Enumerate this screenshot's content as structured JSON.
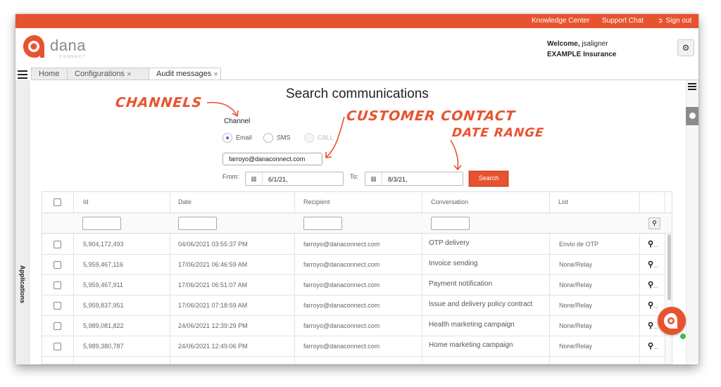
{
  "topbar": {
    "links": [
      "Knowledge Center",
      "Support Chat",
      "Sign out"
    ],
    "color": "#e8532f"
  },
  "logo": {
    "word": "dana",
    "sub": "CONNECT"
  },
  "header": {
    "welcome_prefix": "Welcome,",
    "user": "jsaligner",
    "company": "EXAMPLE Insurance"
  },
  "tabs": [
    {
      "label": "Home",
      "closable": false
    },
    {
      "label": "Configurations",
      "closable": true
    },
    {
      "label": "Audit messages",
      "closable": true,
      "active": true
    }
  ],
  "sidebar": {
    "label": "Applications"
  },
  "page": {
    "title": "Search communications"
  },
  "annotations": {
    "channels": "CHANNELS",
    "customer_contact": "CUSTOMER CONTACT",
    "date_range": "DATE RANGE"
  },
  "form": {
    "channel_label": "Channel",
    "channels": [
      {
        "label": "Email",
        "selected": true,
        "disabled": false
      },
      {
        "label": "SMS",
        "selected": false,
        "disabled": false
      },
      {
        "label": "CALL",
        "selected": false,
        "disabled": true
      }
    ],
    "contact": "farroyo@danaconnect.com",
    "from_label": "From:",
    "from_value": "6/1/21,",
    "to_label": "To:",
    "to_value": "8/3/21,",
    "search_label": "Search"
  },
  "table": {
    "columns": [
      "Id",
      "Date",
      "Recipient",
      "Conversation",
      "List"
    ],
    "rows": [
      {
        "id": "5,904,172,493",
        "date": "04/06/2021 03:55:37 PM",
        "recipient": "farroyo@danaconnect.com",
        "conversation": "OTP delivery",
        "list": "Envio de OTP"
      },
      {
        "id": "5,959,467,116",
        "date": "17/06/2021 06:46:59 AM",
        "recipient": "farroyo@danaconnect.com",
        "conversation": "Invoice sending",
        "list": "None/Relay"
      },
      {
        "id": "5,959,467,911",
        "date": "17/06/2021 06:51:07 AM",
        "recipient": "farroyo@danaconnect.com",
        "conversation": "Payment notification",
        "list": "None/Relay"
      },
      {
        "id": "5,959,837,951",
        "date": "17/06/2021 07:18:59 AM",
        "recipient": "farroyo@danaconnect.com",
        "conversation": "Issue and delivery policy contract",
        "list": "None/Relay"
      },
      {
        "id": "5,989,081,822",
        "date": "24/06/2021 12:39:29 PM",
        "recipient": "farroyo@danaconnect.com",
        "conversation": "Health marketing campaign",
        "list": "None/Relay"
      },
      {
        "id": "5,989,380,787",
        "date": "24/06/2021 12:49:06 PM",
        "recipient": "farroyo@danaconnect.com",
        "conversation": "Home marketing campaign",
        "list": "None/Relay"
      }
    ]
  },
  "icons": {
    "gear": "gears-icon",
    "calendar": "calendar-icon",
    "search": "magnifier-icon",
    "chat": "chat-widget-icon"
  }
}
